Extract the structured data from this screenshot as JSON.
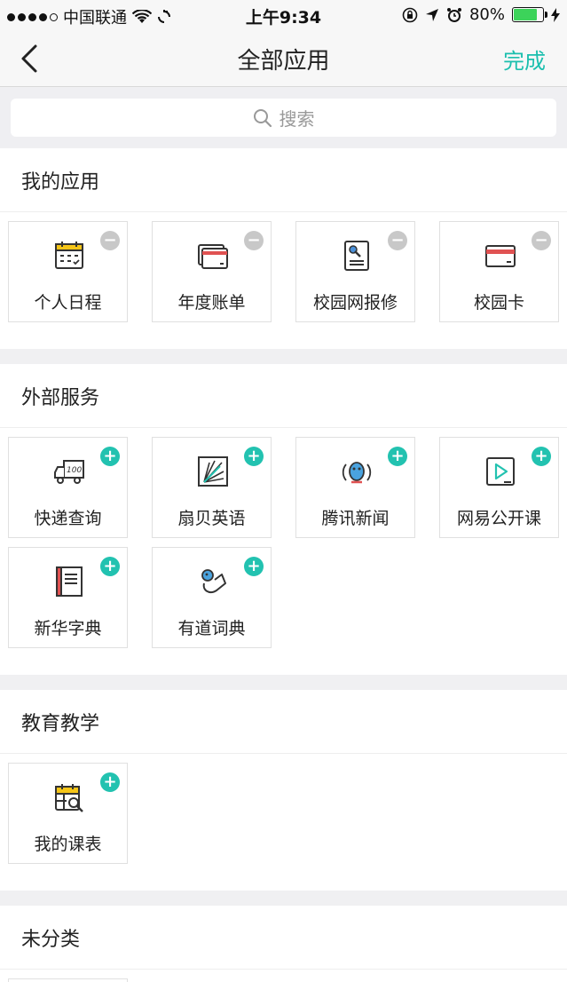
{
  "status": {
    "carrier": "中国联通",
    "time": "上午9:34",
    "battery": "80%",
    "battery_level": 0.8
  },
  "nav": {
    "title": "全部应用",
    "done": "完成"
  },
  "search": {
    "placeholder": "搜索"
  },
  "sections": {
    "my_apps": {
      "title": "我的应用",
      "items": [
        {
          "label": "个人日程"
        },
        {
          "label": "年度账单"
        },
        {
          "label": "校园网报修"
        },
        {
          "label": "校园卡"
        }
      ]
    },
    "external": {
      "title": "外部服务",
      "items": [
        {
          "label": "快递查询"
        },
        {
          "label": "扇贝英语"
        },
        {
          "label": "腾讯新闻"
        },
        {
          "label": "网易公开课"
        },
        {
          "label": "新华字典"
        },
        {
          "label": "有道词典"
        }
      ]
    },
    "education": {
      "title": "教育教学",
      "items": [
        {
          "label": "我的课表"
        }
      ]
    },
    "uncategorized": {
      "title": "未分类"
    }
  },
  "icons": {
    "minus": "−",
    "plus": "+",
    "express_number": "100"
  },
  "colors": {
    "accent": "#1bbfae",
    "plus_badge": "#22c2b0",
    "minus_badge": "#c8c8c8",
    "red": "#e05252",
    "yellow": "#f5c518"
  }
}
